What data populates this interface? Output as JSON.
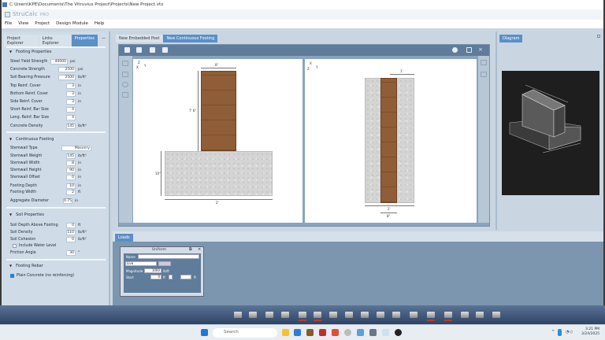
{
  "window": {
    "title": "C:\\Users\\KPE\\Documents\\The Vitruvius Project\\Projects\\New Project.vtx",
    "app_name": "StruCalc",
    "app_edition": "PRO"
  },
  "menu": [
    "File",
    "View",
    "Project",
    "Design Module",
    "Help"
  ],
  "left_panel": {
    "tabs": [
      "Project Explorer",
      "Links Explorer",
      "Properties",
      "—"
    ],
    "active_tab": "Properties",
    "footing_properties": {
      "header": "Footing Properties",
      "rows": [
        {
          "label": "Steel Yield Strength",
          "value": "40000",
          "unit": "psi",
          "type": "select"
        },
        {
          "label": "Concrete Strength",
          "value": "2500",
          "unit": "psi",
          "type": "select"
        },
        {
          "label": "Soil Bearing Pressure",
          "value": "2500",
          "unit": "lb/ft²",
          "type": "select"
        },
        {
          "label": "Top Reinf. Cover",
          "value": "3",
          "unit": "in",
          "type": "input"
        },
        {
          "label": "Bottom Reinf. Cover",
          "value": "3",
          "unit": "in",
          "type": "input"
        },
        {
          "label": "Side Reinf. Cover",
          "value": "3",
          "unit": "in",
          "type": "input"
        },
        {
          "label": "Short Reinf. Bar Size",
          "value": "4",
          "unit": "",
          "type": "spinner"
        },
        {
          "label": "Long. Reinf. Bar Size",
          "value": "4",
          "unit": "",
          "type": "spinner"
        },
        {
          "label": "Concrete Density",
          "value": "145",
          "unit": "lb/ft³",
          "type": "input"
        }
      ]
    },
    "continuous_footing": {
      "header": "Continuous Footing",
      "rows": [
        {
          "label": "Stemwall Type",
          "value": "Masonry",
          "unit": "",
          "type": "select"
        },
        {
          "label": "Stemwall Weight",
          "value": "145",
          "unit": "lb/ft³",
          "type": "input"
        },
        {
          "label": "Stemwall Width",
          "value": "8",
          "unit": "in",
          "type": "input"
        },
        {
          "label": "Stemwall Height",
          "value": "90",
          "unit": "in",
          "type": "input"
        },
        {
          "label": "Stemwall Offset",
          "value": "0",
          "unit": "in",
          "type": "input"
        },
        {
          "label": "Footing Depth",
          "value": "10",
          "unit": "in",
          "type": "input"
        },
        {
          "label": "Footing Width",
          "value": "2",
          "unit": "ft",
          "type": "input"
        },
        {
          "label": "Aggregate Diameter",
          "value": "0.75",
          "unit": "in",
          "type": "input"
        }
      ]
    },
    "soil_properties": {
      "header": "Soil Properties",
      "rows": [
        {
          "label": "Soil Depth Above Footing",
          "value": "0",
          "unit": "ft"
        },
        {
          "label": "Soil Density",
          "value": "110",
          "unit": "lb/ft³"
        },
        {
          "label": "Soil Cohesion",
          "value": "0",
          "unit": "lb/ft²"
        }
      ],
      "water_level_label": "Include Water Level",
      "water_level_checked": false,
      "friction": {
        "label": "Friction Angle",
        "value": "30",
        "unit": "°"
      }
    },
    "footing_rebar": {
      "header": "Footing Rebar",
      "plain_concrete_label": "Plain Concrete (no reinforcing)",
      "plain_concrete_checked": true
    }
  },
  "center": {
    "tabs": [
      "New Embedded Post",
      "New Continuous Footing"
    ],
    "active_tab": "New Continuous Footing",
    "view1": {
      "axis_z": "Z",
      "axis_y": "Y",
      "axis_x": "X",
      "dim_stem_width": "8\"",
      "dim_stem_height": "7' 6\"",
      "dim_footing_depth": "10\"",
      "dim_footing_width": "2'"
    },
    "view2": {
      "axis_x": "X",
      "axis_y": "Y",
      "axis_z": "Z",
      "dim_half": "1'",
      "dim_footing_width": "2'",
      "dim_stem_width": "8\""
    }
  },
  "loads": {
    "tab": "Loads",
    "window_title": "Uniform",
    "name_label": "Name",
    "name_value": "",
    "type_value": "Live",
    "magnitude_label": "Magnitude",
    "magnitude_value": "1000",
    "magnitude_unit": "lb/ft",
    "start_label": "Start",
    "start_value": "0",
    "start_unit": "ft",
    "end_value": "",
    "end_unit": "ft"
  },
  "diagram": {
    "tab": "Diagram"
  },
  "taskbar": {
    "search_placeholder": "Search",
    "time": "3:21 PM",
    "date": "3/24/2025"
  },
  "colors": {
    "accent": "#5b8fc7",
    "stemwall": "#8f5e38",
    "concrete": "#d4d4d4"
  }
}
